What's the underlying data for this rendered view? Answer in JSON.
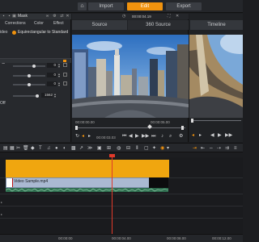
{
  "topbar": {
    "home_icon": "home-icon",
    "tabs": [
      {
        "label": "Import",
        "active": false
      },
      {
        "label": "Edit",
        "active": true
      },
      {
        "label": "Export",
        "active": false
      }
    ]
  },
  "left_panel": {
    "header_label": "Mask",
    "tabs": [
      "Corrections",
      "Color",
      "Effect"
    ],
    "video_label": "ideo",
    "projection_label": "Equirectangular to Standard",
    "field_values": [
      "0",
      "0",
      "0",
      "1562"
    ],
    "off_label": "Off"
  },
  "source_viewer": {
    "header_time": "00:00:04.19",
    "tabs": [
      "Source",
      "360 Source"
    ],
    "scrub_start": "00:00:00.00",
    "scrub_mid": "00:00:05.00",
    "transport_time": "00:00:03.03"
  },
  "timeline_viewer": {
    "tab_label": "Timeline"
  },
  "timeline": {
    "video_clip_name": "Video Sample.mp4",
    "bottom_times": [
      "00:00:00",
      "00:00:04.00",
      "00:00:08.00",
      "00:00:12.00"
    ]
  },
  "colors": {
    "accent": "#f0920e",
    "title_clip": "#f0a60f",
    "video_clip": "#aab9d2",
    "audio_clip": "#2f6d4f",
    "playhead": "#e03a2a"
  }
}
